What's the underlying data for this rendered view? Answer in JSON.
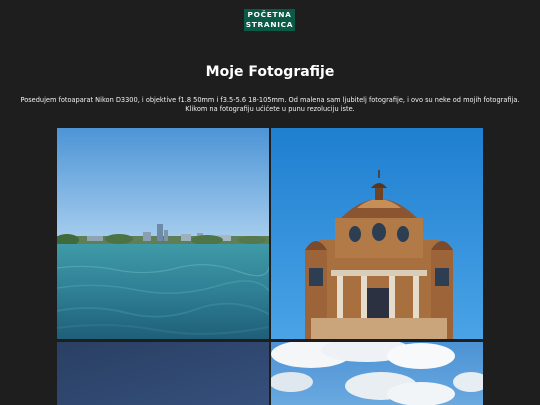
{
  "nav": {
    "home_label_line1": "POČETNA",
    "home_label_line2": "STRANICA"
  },
  "page": {
    "title": "Moje Fotografije",
    "intro_line1": "Posedujem fotoaparat Nikon D3300, i objektive f1.8 50mm i f3.5-5.6 18-105mm. Od malena sam ljubitelj fotografije, i ovo su neke od mojih fotografija.",
    "intro_line2": "Klikom na fotografiju ućićete u punu rezoluciju iste."
  },
  "colors": {
    "background": "#1e1e1e",
    "accent": "#0b5a47",
    "text": "#ffffff"
  },
  "gallery": {
    "photos": [
      {
        "subject": "lake-skyline-photo"
      },
      {
        "subject": "brick-tower-photo"
      },
      {
        "subject": "night-sky-photo"
      },
      {
        "subject": "clouds-photo"
      }
    ]
  }
}
